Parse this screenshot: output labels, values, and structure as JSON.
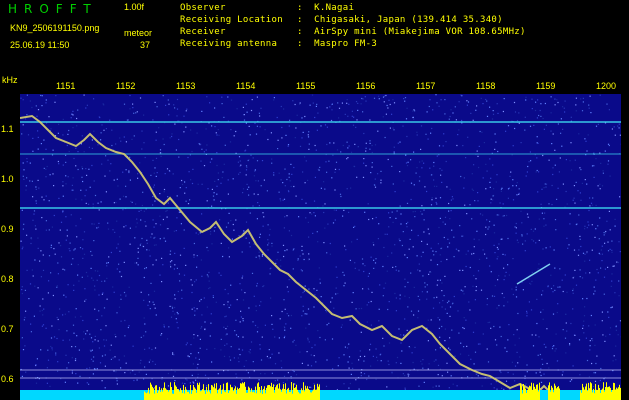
{
  "header": {
    "app_title": "HROFFT",
    "version": "1.00f",
    "filename": "KN9_2506191150.png",
    "datetime": "25.06.19 11:50",
    "meteor_label": "meteor",
    "meteor_count": "37",
    "info": [
      {
        "label": "Observer",
        "value": ":  K.Nagai"
      },
      {
        "label": "Receiving Location",
        "value": ":  Chigasaki, Japan (139.414 35.340)"
      },
      {
        "label": "Receiver",
        "value": ":  AirSpy mini (Miakejima VOR 108.65MHz)"
      },
      {
        "label": "Receiving antenna",
        "value": ":  Maspro FM-3"
      }
    ]
  },
  "axes": {
    "y_unit": "kHz",
    "y_ticks": [
      "1.1",
      "1.0",
      "0.9",
      "0.8",
      "0.7",
      "0.6"
    ],
    "x_ticks": [
      "1151",
      "1152",
      "1153",
      "1154",
      "1155",
      "1156",
      "1157",
      "1158",
      "1159",
      "1200"
    ]
  },
  "colors": {
    "background": "#000000",
    "text": "#ffff00",
    "title": "#00d000",
    "plot_bg": "#0a0a8a",
    "carrier": "#38c8e8",
    "noise_bar": "#00d8ff",
    "meteor_bar": "#ffff00"
  }
}
